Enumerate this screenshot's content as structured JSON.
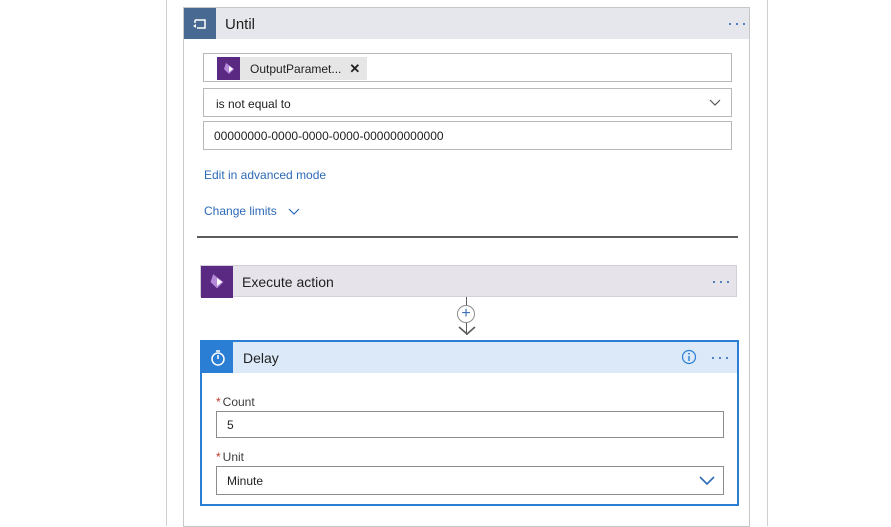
{
  "until": {
    "title": "Until",
    "condition": {
      "token_label": "OutputParamet...",
      "operator": "is not equal to",
      "value": "00000000-0000-0000-0000-000000000000"
    },
    "advanced_link": "Edit in advanced mode",
    "limits_link": "Change limits"
  },
  "execute_action": {
    "title": "Execute action"
  },
  "delay": {
    "title": "Delay",
    "count_label": "Count",
    "count_value": "5",
    "unit_label": "Unit",
    "unit_value": "Minute",
    "required_marker": "*"
  },
  "colors": {
    "until_accent": "#486991",
    "dataverse_purple": "#5a2a82",
    "delay_blue": "#2a7fd4",
    "link_blue": "#2d6ab6"
  },
  "icons": {
    "until": "loop-icon",
    "execute": "dataverse-icon",
    "delay": "timer-icon",
    "info": "info-icon",
    "more": "more-icon",
    "add": "plus-icon"
  }
}
